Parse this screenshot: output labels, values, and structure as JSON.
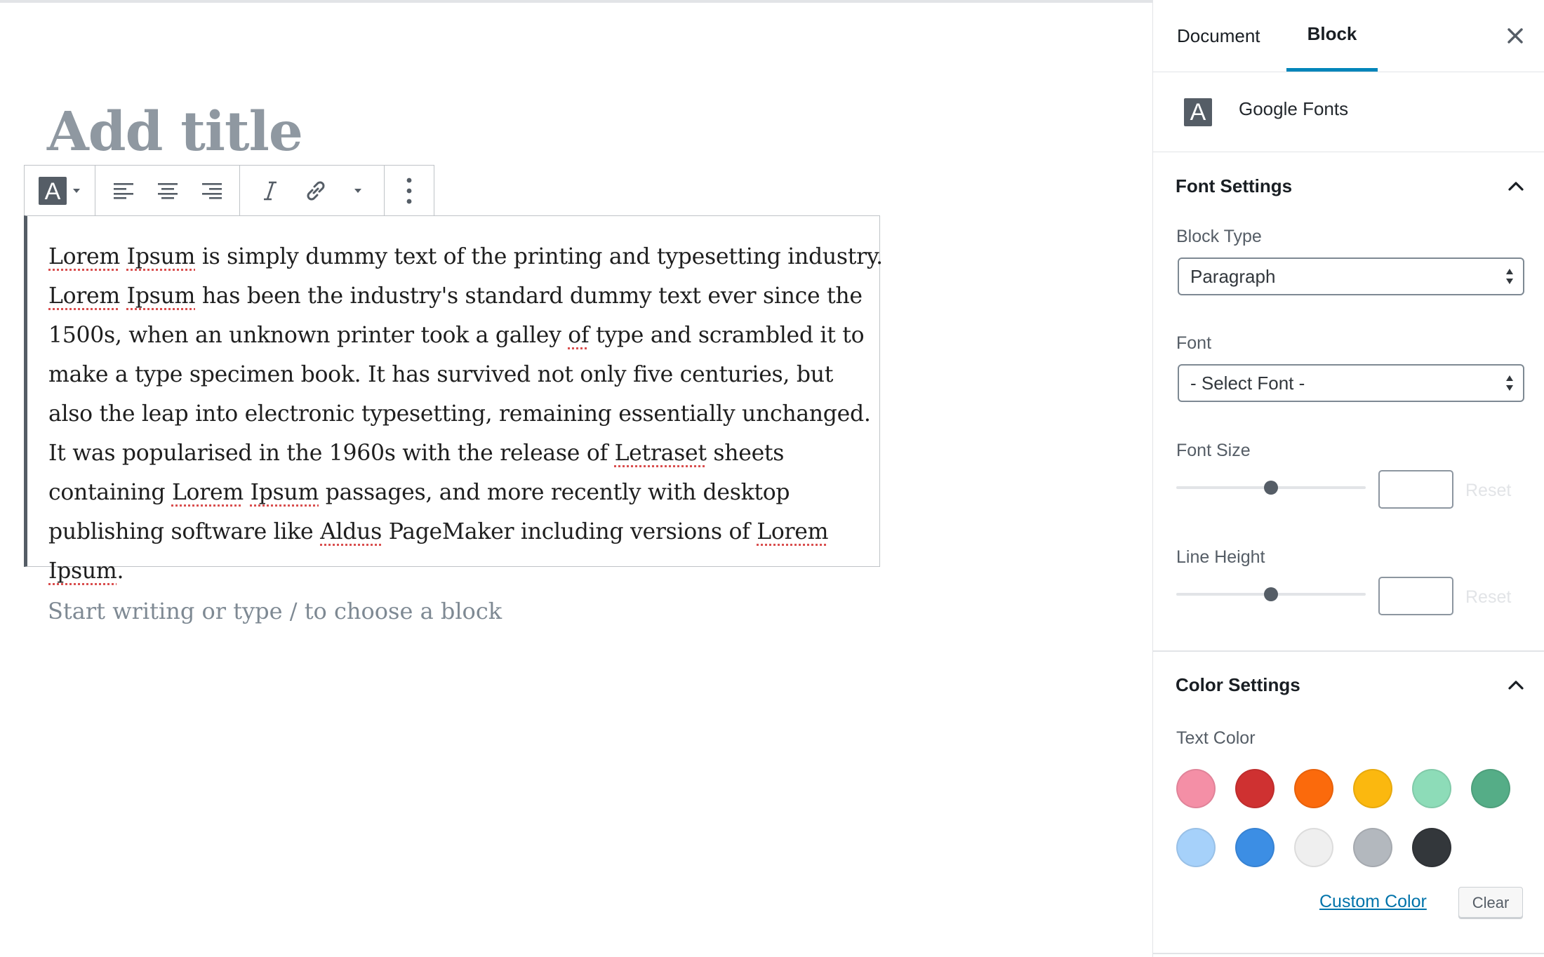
{
  "editor": {
    "title_placeholder": "Add title",
    "paragraph": {
      "segments": [
        {
          "t": "Lorem",
          "s": true
        },
        {
          "t": " "
        },
        {
          "t": "Ipsum",
          "s": true
        },
        {
          "t": " is simply dummy text of the printing and typesetting industry. "
        },
        {
          "t": "Lorem",
          "s": true
        },
        {
          "t": " "
        },
        {
          "t": "Ipsum",
          "s": true
        },
        {
          "t": " has been the industry's standard dummy text ever since the 1500s, when an unknown printer took a galley "
        },
        {
          "t": "of",
          "s": true
        },
        {
          "t": " type and scrambled it to make a type specimen book. It has survived not only five centuries, but also the leap into electronic typesetting, remaining essentially unchanged. It was popularised in the 1960s with the release of "
        },
        {
          "t": "Letraset",
          "s": true
        },
        {
          "t": " sheets containing "
        },
        {
          "t": "Lorem",
          "s": true
        },
        {
          "t": " "
        },
        {
          "t": "Ipsum",
          "s": true
        },
        {
          "t": " passages, and more recently with desktop publishing software like "
        },
        {
          "t": "Aldus",
          "s": true
        },
        {
          "t": " PageMaker including versions of "
        },
        {
          "t": "Lorem",
          "s": true
        },
        {
          "t": " "
        },
        {
          "t": "Ipsum",
          "s": true
        },
        {
          "t": "."
        }
      ]
    },
    "new_block_placeholder": "Start writing or type / to choose a block",
    "toolbar": {
      "icons": [
        "google-fonts-icon",
        "align-left-icon",
        "align-center-icon",
        "align-right-icon",
        "italic-icon",
        "link-icon",
        "more-rich-text-dropdown-icon",
        "more-options-icon"
      ]
    }
  },
  "sidebar": {
    "tabs": [
      {
        "label": "Document",
        "active": false
      },
      {
        "label": "Block",
        "active": true
      }
    ],
    "plugin": {
      "icon": "A",
      "name": "Google Fonts"
    },
    "font_settings": {
      "title": "Font Settings",
      "block_type_label": "Block Type",
      "block_type_value": "Paragraph",
      "font_label": "Font",
      "font_value": "- Select Font -",
      "font_size_label": "Font Size",
      "font_size_value": "",
      "font_size_slider": 0.5,
      "line_height_label": "Line Height",
      "line_height_value": "",
      "line_height_slider": 0.5,
      "reset_label": "Reset"
    },
    "color_settings": {
      "title": "Color Settings",
      "text_color_label": "Text Color",
      "swatches": [
        "#f78da7",
        "#cf2e2e",
        "#ff6900",
        "#fcb900",
        "#7bdcb5",
        "#00d084",
        "#8ed1fc",
        "#0693e3",
        "#eeeeee",
        "#abb8c3",
        "#313131"
      ],
      "swatch_colors_rendered": [
        "#f48fa6",
        "#cf3131",
        "#fb6a0c",
        "#fbb80f",
        "#8ddcb8",
        "#55ad87",
        "#a6d1fa",
        "#3c8ee4",
        "#efefef",
        "#b3b8be",
        "#33373b"
      ],
      "custom_color_label": "Custom Color",
      "clear_label": "Clear"
    }
  }
}
